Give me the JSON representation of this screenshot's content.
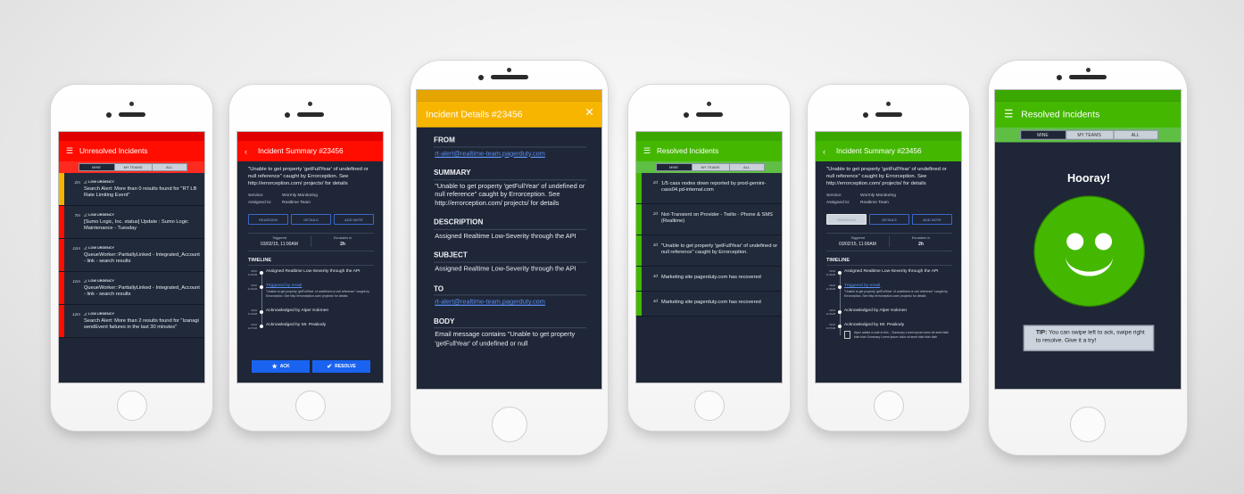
{
  "themes": {
    "red": {
      "status": "#e00000",
      "header": "#ff0d00",
      "tabs": "#ff2a1f"
    },
    "orange": {
      "status": "#e6a400",
      "header": "#f8b500",
      "tabs": "#f8b500"
    },
    "green": {
      "status": "#3aa800",
      "header": "#44b800",
      "tabs": "#5fbf45"
    }
  },
  "colors": {
    "background": "#1e2637",
    "accent_blue": "#1a63f0",
    "link": "#5b8ff0",
    "strip_yellow": "#f5b400",
    "strip_red": "#ff0d00",
    "strip_green": "#44b800"
  },
  "phones": [
    {
      "type": "list",
      "theme": "red",
      "size": "small",
      "header": {
        "title": "Unresolved Incidents",
        "icon": "hamburger-icon"
      },
      "tabs": [
        "MINE",
        "MY TEAMS",
        "ALL"
      ],
      "active_tab": 0,
      "items": [
        {
          "time": "2m",
          "urgency": "LOW URGENCY",
          "title": "Search Alert: More than 0 results found for \"RT LB Rate Limiting Event\"",
          "strip": "#f5b400"
        },
        {
          "time": "7m",
          "urgency": "LOW URGENCY",
          "title": "[Sumo Logic, Inc. status] Update : Sumo Logic Maintenance - Tuesday",
          "strip": "#ff0d00"
        },
        {
          "time": "11m",
          "urgency": "LOW URGENCY",
          "title": "QueueWorker::PartiallyLinked - Integrated_Account - link - search results",
          "strip": "#ff0d00"
        },
        {
          "time": "11m",
          "urgency": "LOW URGENCY",
          "title": "QueueWorker::PartiallyLinked - Integrated_Account - link - search results",
          "strip": "#ff0d00"
        },
        {
          "time": "12m",
          "urgency": "LOW URGENCY",
          "title": "Search Alert: More than 2 results found for \"Izanagi sendEvent failures in the last 30 minutes\"",
          "strip": "#ff0d00"
        }
      ]
    },
    {
      "type": "summary",
      "theme": "red",
      "size": "small",
      "header": {
        "title": "Incident Summary #23456",
        "icon": "chevron-left-icon"
      },
      "description": "\"Unable to get property 'getFullYear' of undefined or null reference\" caught by Errorception. See http://errorception.com/ projects/ for details",
      "fields": [
        {
          "label": "Service:",
          "value": "Wormly Monitoring"
        },
        {
          "label": "Assigned to:",
          "value": "Realtime Team"
        }
      ],
      "buttons": [
        "REASSIGN",
        "DETAILS",
        "ADD NOTE"
      ],
      "active_button": -1,
      "triggered_label": "Triggered",
      "triggered_value": "03/02/15, 11:00AM",
      "escalates_label": "Escalates in",
      "escalates_value": "2h",
      "timeline_label": "TIMELINE",
      "timeline": [
        {
          "date": "03/02",
          "time": "11:00AM",
          "text": "Assigned Realtime Low-Severity through the API"
        },
        {
          "date": "03/02",
          "time": "11:00AM",
          "link": "Triggered by email",
          "detail": "\"Unable to get property 'getFullYear' of undefined or null reference\" caught by Errorception. See http://errorception.com/ projects/ for details"
        },
        {
          "date": "03/02",
          "time": "11:02AM",
          "text": "Acknowledged by Alper Kokmen"
        },
        {
          "date": "03/02",
          "time": "11:07AM",
          "text": "Acknowledged by Mr. Peabody"
        }
      ],
      "actions": [
        {
          "label": "ACK",
          "icon": "star-icon"
        },
        {
          "label": "RESOLVE",
          "icon": "checkmark-icon"
        }
      ]
    },
    {
      "type": "details",
      "theme": "orange",
      "size": "big",
      "header": {
        "title": "Incident Details #23456",
        "icon": "close-icon"
      },
      "sections": [
        {
          "label": "FROM",
          "value": "rt-alert@realtime-team.pagerduty.com",
          "link": true
        },
        {
          "label": "SUMMARY",
          "value": "\"Unable to get property 'getFullYear' of undefined or null reference\" caught by Errorception. See http://errorception.com/ projects/ for details",
          "link": false
        },
        {
          "label": "DESCRIPTION",
          "value": "Assigned Realtime Low-Severity through the API",
          "link": false
        },
        {
          "label": "SUBJECT",
          "value": "Assigned Realtime Low-Severity through the API",
          "link": false
        },
        {
          "label": "TO",
          "value": "rt-alert@realtime-team.pagerduty.com",
          "link": true
        },
        {
          "label": "BODY",
          "value": "Email message contains \"Unable to get property 'getFullYear' of undefined or null",
          "link": false
        }
      ]
    },
    {
      "type": "list",
      "theme": "green",
      "size": "small",
      "header": {
        "title": "Resolved Incidents",
        "icon": "hamburger-icon"
      },
      "tabs": [
        "MINE",
        "MY TEAMS",
        "ALL"
      ],
      "active_tab": 0,
      "items": [
        {
          "time": "2d",
          "title": "1/5 cass nodes down reported by prod-gemini-cass04.pd-internal.com",
          "strip": "#44b800"
        },
        {
          "time": "2d",
          "title": "Not-Transient on Provider - Twilio - Phone & SMS (Realtime)",
          "strip": "#44b800"
        },
        {
          "time": "3d",
          "title": "\"Unable to get property 'getFullYear' of undefined or null reference\" caught by Errorception.",
          "strip": "#44b800"
        },
        {
          "time": "4d",
          "title": "Marketing site pagerduty.com has recovered",
          "strip": "#44b800"
        },
        {
          "time": "4d",
          "title": "Marketing site pagerduty.com has recovered",
          "strip": "#44b800"
        }
      ]
    },
    {
      "type": "summary",
      "theme": "green",
      "size": "small",
      "header": {
        "title": "Incident Summary #23456",
        "icon": "chevron-left-icon"
      },
      "description": "\"Unable to get property 'getFullYear' of undefined or null reference\" caught by Errorception. See http://errorception.com/ projects/ for details",
      "fields": [
        {
          "label": "Service:",
          "value": "Wormly Monitoring"
        },
        {
          "label": "Assigned to:",
          "value": "Realtime Team"
        }
      ],
      "buttons": [
        "REASSIGN",
        "DETAILS",
        "ADD NOTE"
      ],
      "active_button": 0,
      "triggered_label": "Triggered",
      "triggered_value": "03/02/15, 11:00AM",
      "escalates_label": "Escalates in",
      "escalates_value": "2h",
      "timeline_label": "TIMELINE",
      "timeline": [
        {
          "date": "03/02",
          "time": "11:00AM",
          "text": "Assigned Realtime Low-Severity through the API"
        },
        {
          "date": "03/02",
          "time": "11:00AM",
          "link": "Triggered by email",
          "detail": "\"Unable to get property 'getFullYear' of undefined or null reference\" caught by Errorception. See http://errorception.com/ projects/ for details"
        },
        {
          "date": "03/02",
          "time": "11:02AM",
          "text": "Acknowledged by Alper Kokmen"
        },
        {
          "date": "03/02",
          "time": "11:07AM",
          "text": "Acknowledged by Mr. Peabody",
          "note": "Alper added a note to this ...Summary Lorem ipsum dolor sit amet blah blah blah Summary Lorem ipsum dolor sit amet blah blah blah"
        }
      ]
    },
    {
      "type": "hooray",
      "theme": "green",
      "size": "big",
      "header": {
        "title": "Resolved Incidents",
        "icon": "hamburger-icon"
      },
      "tabs": [
        "MINE",
        "MY TEAMS",
        "ALL"
      ],
      "active_tab": 0,
      "heading": "Hooray!",
      "tip_label": "TIP:",
      "tip_text": " You can swipe left to ack, swipe right to resolve. Give it a try!"
    }
  ]
}
